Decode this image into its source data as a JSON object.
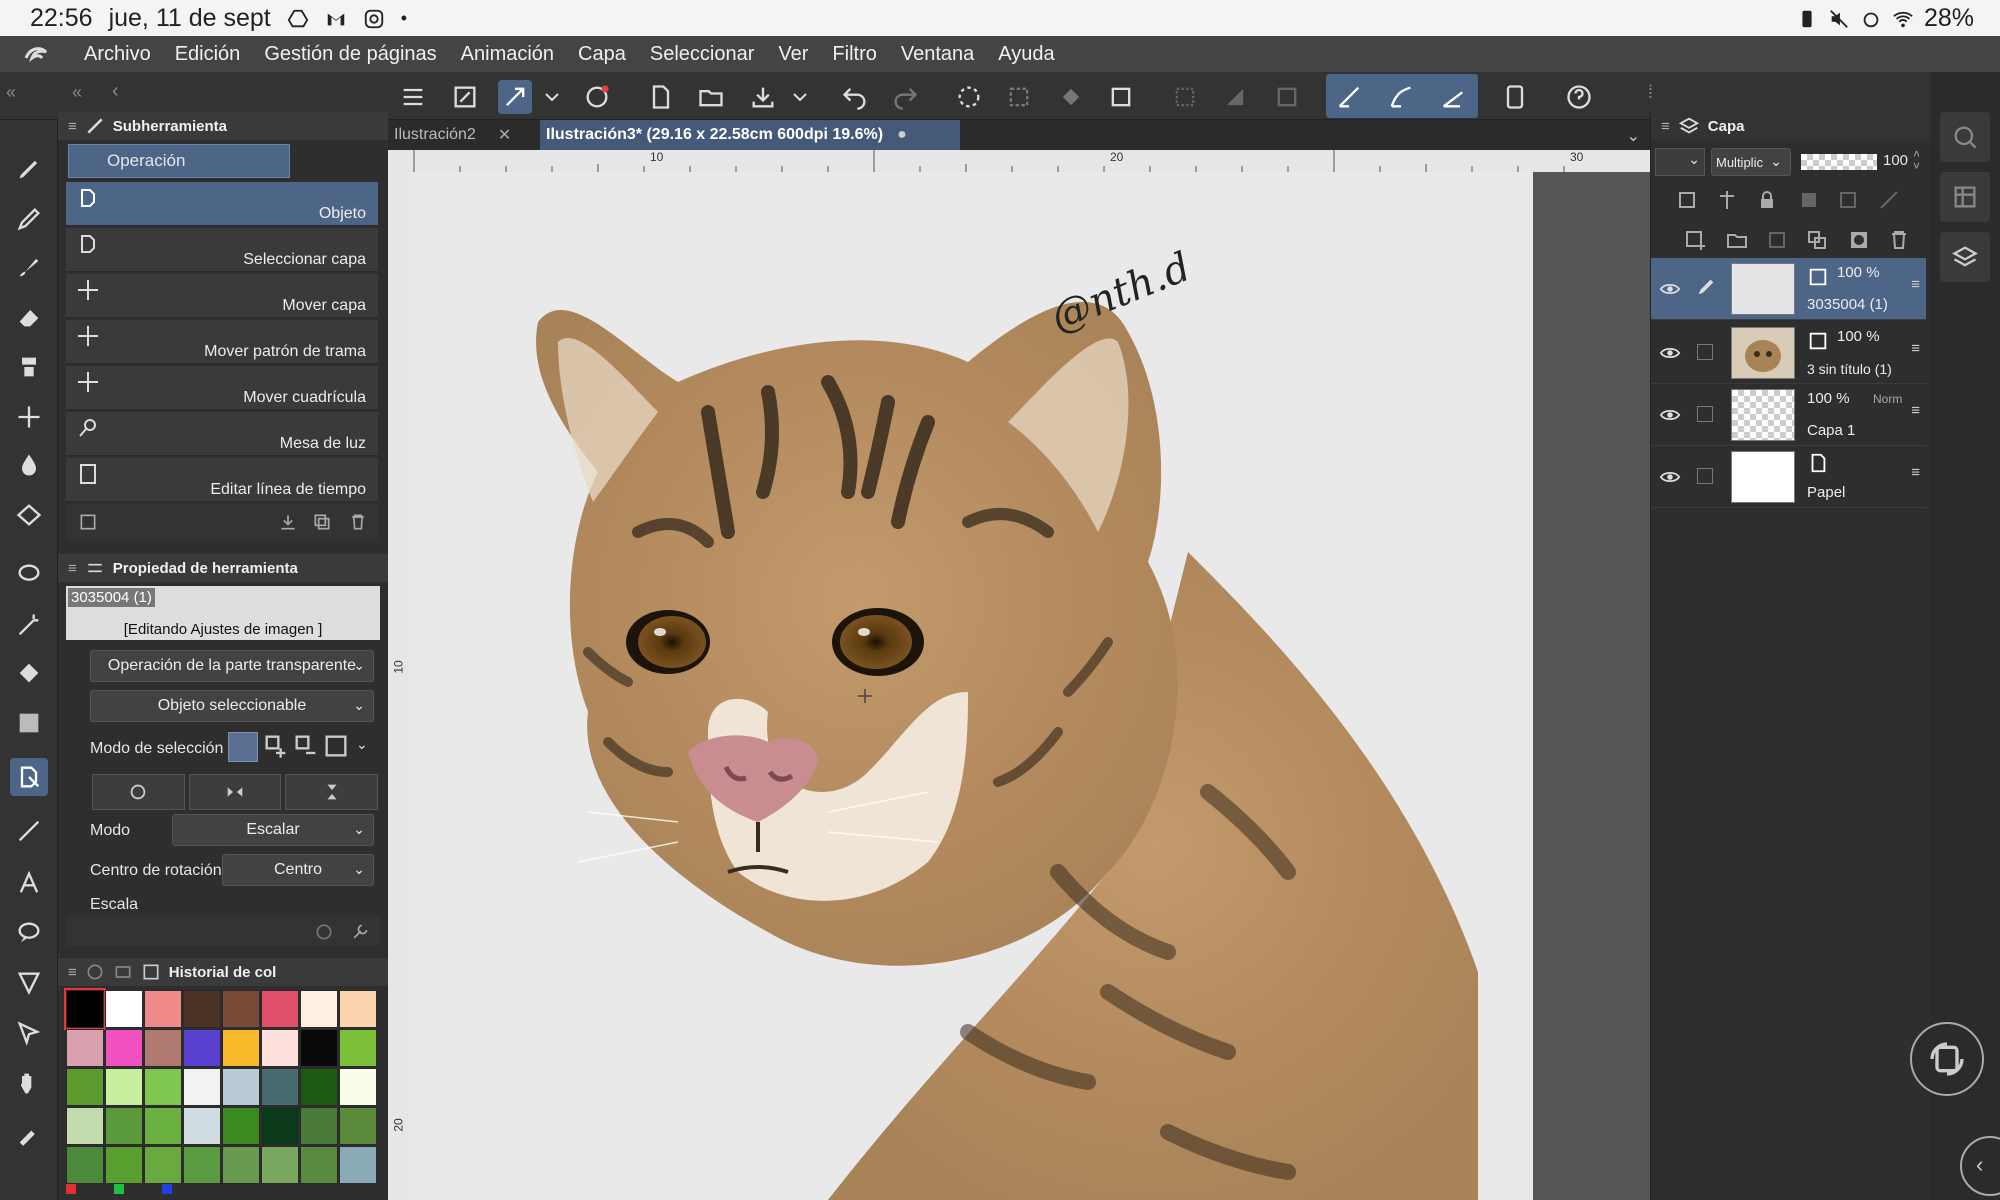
{
  "status_bar": {
    "time": "22:56",
    "date": "jue, 11 de sept",
    "battery": "28%"
  },
  "menu": {
    "items": [
      "Archivo",
      "Edición",
      "Gestión de páginas",
      "Animación",
      "Capa",
      "Seleccionar",
      "Ver",
      "Filtro",
      "Ventana",
      "Ayuda"
    ]
  },
  "tabs": {
    "first": "Ilustración2",
    "active": "Ilustración3* (29.16 x 22.58cm 600dpi 19.6%)"
  },
  "ruler": {
    "h_ticks": [
      "10",
      "20",
      "30"
    ],
    "v_ticks": [
      "10",
      "20"
    ]
  },
  "subtool": {
    "panel_title": "Subherramienta",
    "group": "Operación",
    "items": [
      "Objeto",
      "Seleccionar capa",
      "Mover capa",
      "Mover patrón de trama",
      "Mover cuadrícula",
      "Mesa de luz",
      "Editar línea de tiempo"
    ]
  },
  "tool_property": {
    "panel_title": "Propiedad de herramienta",
    "layer_name": "3035004 (1)",
    "editing_label": "[Editando Ajustes de imagen ]",
    "transparent_op": "Operación de la parte transparente",
    "selectable": "Objeto seleccionable",
    "selection_mode_label": "Modo de selección",
    "mode_label": "Modo",
    "mode_value": "Escalar",
    "rotation_center_label": "Centro de rotación",
    "rotation_center_value": "Centro",
    "scale_label": "Escala"
  },
  "color_history": {
    "title": "Historial de col",
    "swatches": [
      "#000000",
      "#ffffff",
      "#f08a8a",
      "#4a3324",
      "#7a4a38",
      "#e0506a",
      "#fdf0e0",
      "#fbd5b0",
      "#d9a1b0",
      "#f050c0",
      "#b07a70",
      "#5a40d0",
      "#f7b92a",
      "#fde0de",
      "#0a0a0a",
      "#7cc03a",
      "#5a9a2e",
      "#c8eea0",
      "#7ec850",
      "#f2f2f2",
      "#b8cad4",
      "#4a6a72",
      "#1e5a14",
      "#fafde8",
      "#c2dcb0",
      "#5a9a3a",
      "#6ab040",
      "#d0dce2",
      "#3a8a20",
      "#0a3a1a",
      "#4a7a3a",
      "#5a8a3a",
      "#4a8a3a",
      "#5aa030",
      "#6aa840",
      "#5a9a40",
      "#6a9a50",
      "#7aa860",
      "#5a8a40",
      "#8aaab8"
    ]
  },
  "canvas": {
    "signature": "@nth.d"
  },
  "layers_panel": {
    "title": "Capa",
    "blend_mode": "Multiplic",
    "opacity": "100",
    "layers": [
      {
        "name": "3035004 (1)",
        "opacity": "100 %",
        "mode": ""
      },
      {
        "name": "3 sin título (1)",
        "opacity": "100 %",
        "mode": ""
      },
      {
        "name": "Capa 1",
        "opacity": "100 %",
        "mode": "Norm"
      },
      {
        "name": "Papel",
        "opacity": "",
        "mode": ""
      }
    ]
  }
}
